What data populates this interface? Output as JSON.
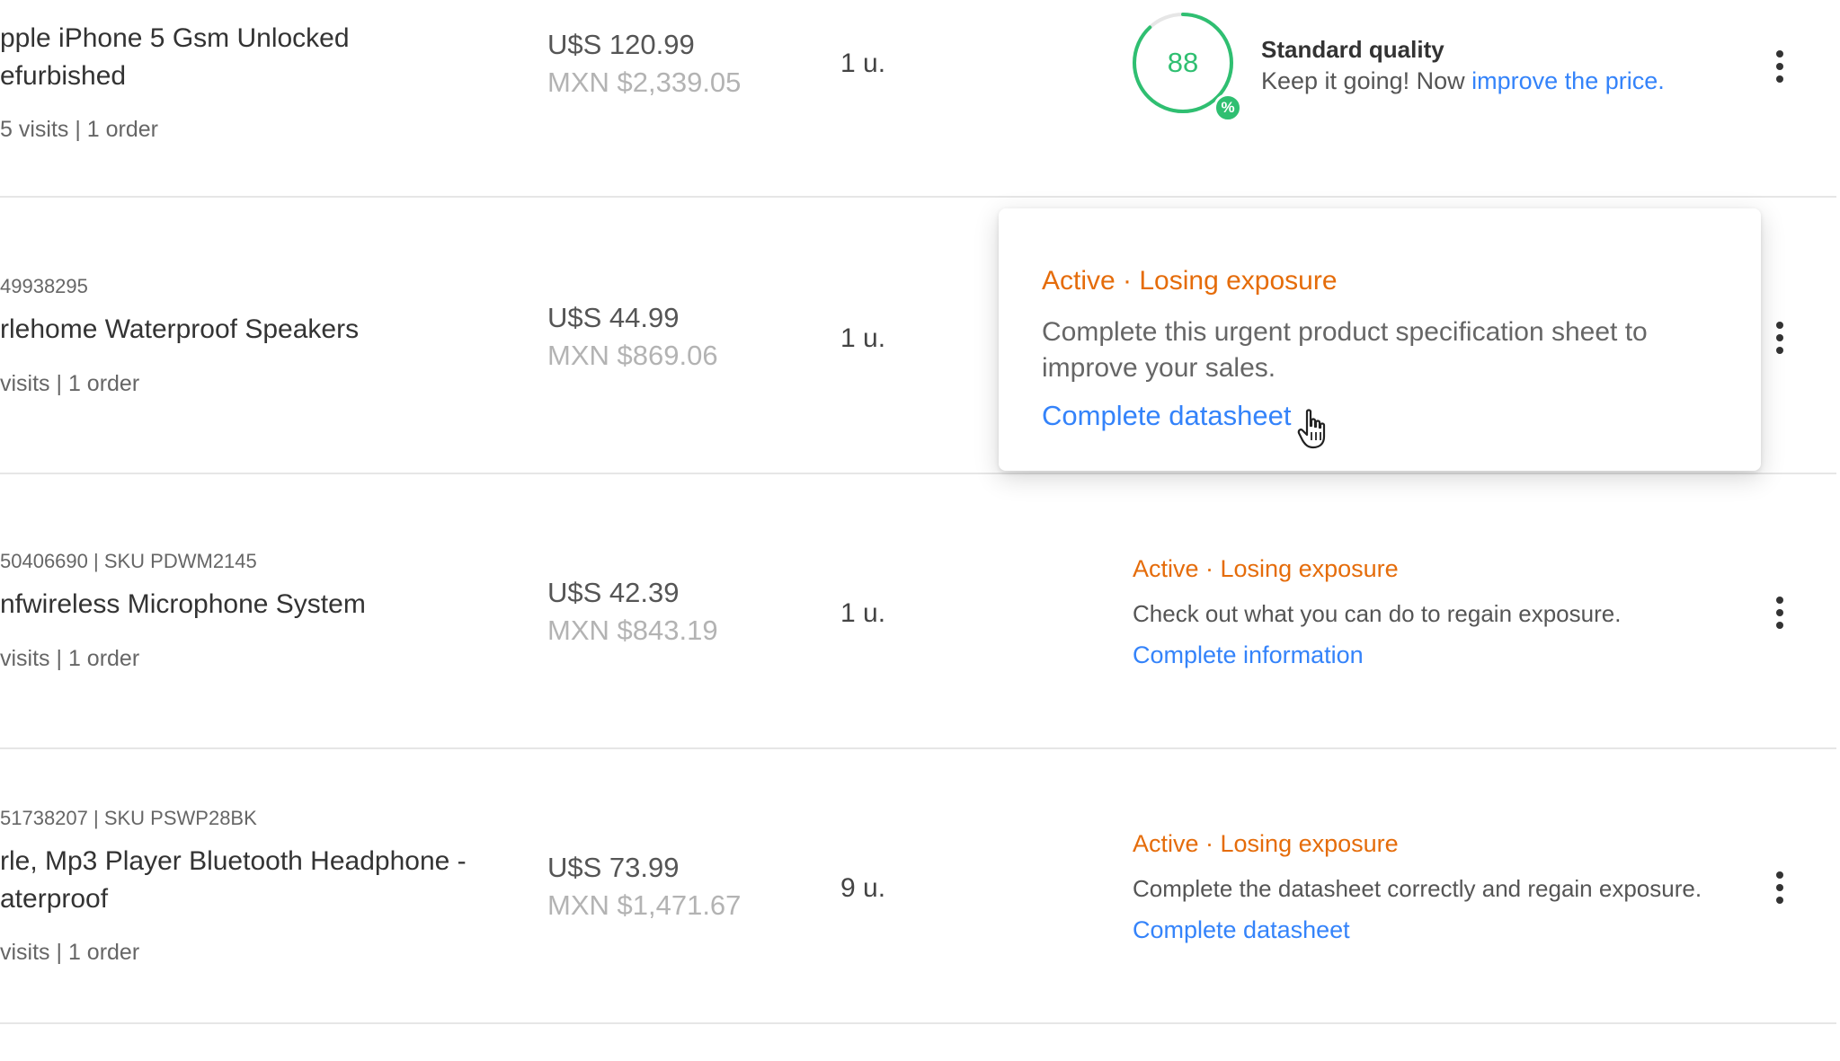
{
  "colors": {
    "accent_blue": "#3483fa",
    "warning_orange": "#e56c0a",
    "quality_green": "#2fbf71",
    "divider": "#e6e6e6",
    "muted_text": "#b3b3b3"
  },
  "listings": [
    {
      "meta": "",
      "title_lines": [
        "pple iPhone 5 Gsm Unlocked",
        "efurbished"
      ],
      "stats": "5 visits | 1 order",
      "price_usd": "U$S 120.99",
      "price_mxn": "MXN $2,339.05",
      "quantity": "1 u.",
      "quality": {
        "score": "88",
        "score_fraction": 0.88,
        "badge_icon": "percent-icon",
        "title": "Standard quality",
        "desc_prefix": "Keep it going! Now ",
        "link": "improve the price."
      }
    },
    {
      "meta": "49938295",
      "title_lines": [
        "rlehome Waterproof Speakers"
      ],
      "stats": "visits | 1 order",
      "price_usd": "U$S 44.99",
      "price_mxn": "MXN $869.06",
      "quantity": "1 u."
    },
    {
      "meta": "50406690 | SKU PDWM2145",
      "title_lines": [
        "nfwireless Microphone System"
      ],
      "stats": "visits | 1 order",
      "price_usd": "U$S 42.39",
      "price_mxn": "MXN $843.19",
      "quantity": "1 u.",
      "status": {
        "title": "Active · Losing exposure",
        "desc": "Check out what you can do to regain exposure.",
        "link": "Complete information"
      }
    },
    {
      "meta": "51738207 | SKU PSWP28BK",
      "title_lines": [
        "rle, Mp3 Player Bluetooth Headphone -",
        "aterproof"
      ],
      "stats": "visits | 1 order",
      "price_usd": "U$S 73.99",
      "price_mxn": "MXN $1,471.67",
      "quantity": "9 u.",
      "status": {
        "title": "Active · Losing exposure",
        "desc": "Complete the datasheet correctly and regain exposure.",
        "link": "Complete datasheet"
      }
    }
  ],
  "popover": {
    "title": "Active · Losing exposure",
    "desc": "Complete this urgent product specification sheet to improve your sales.",
    "link": "Complete datasheet"
  },
  "icons": {
    "row_menu": "more-vertical-icon",
    "pointer": "hand-pointer-cursor-icon"
  }
}
